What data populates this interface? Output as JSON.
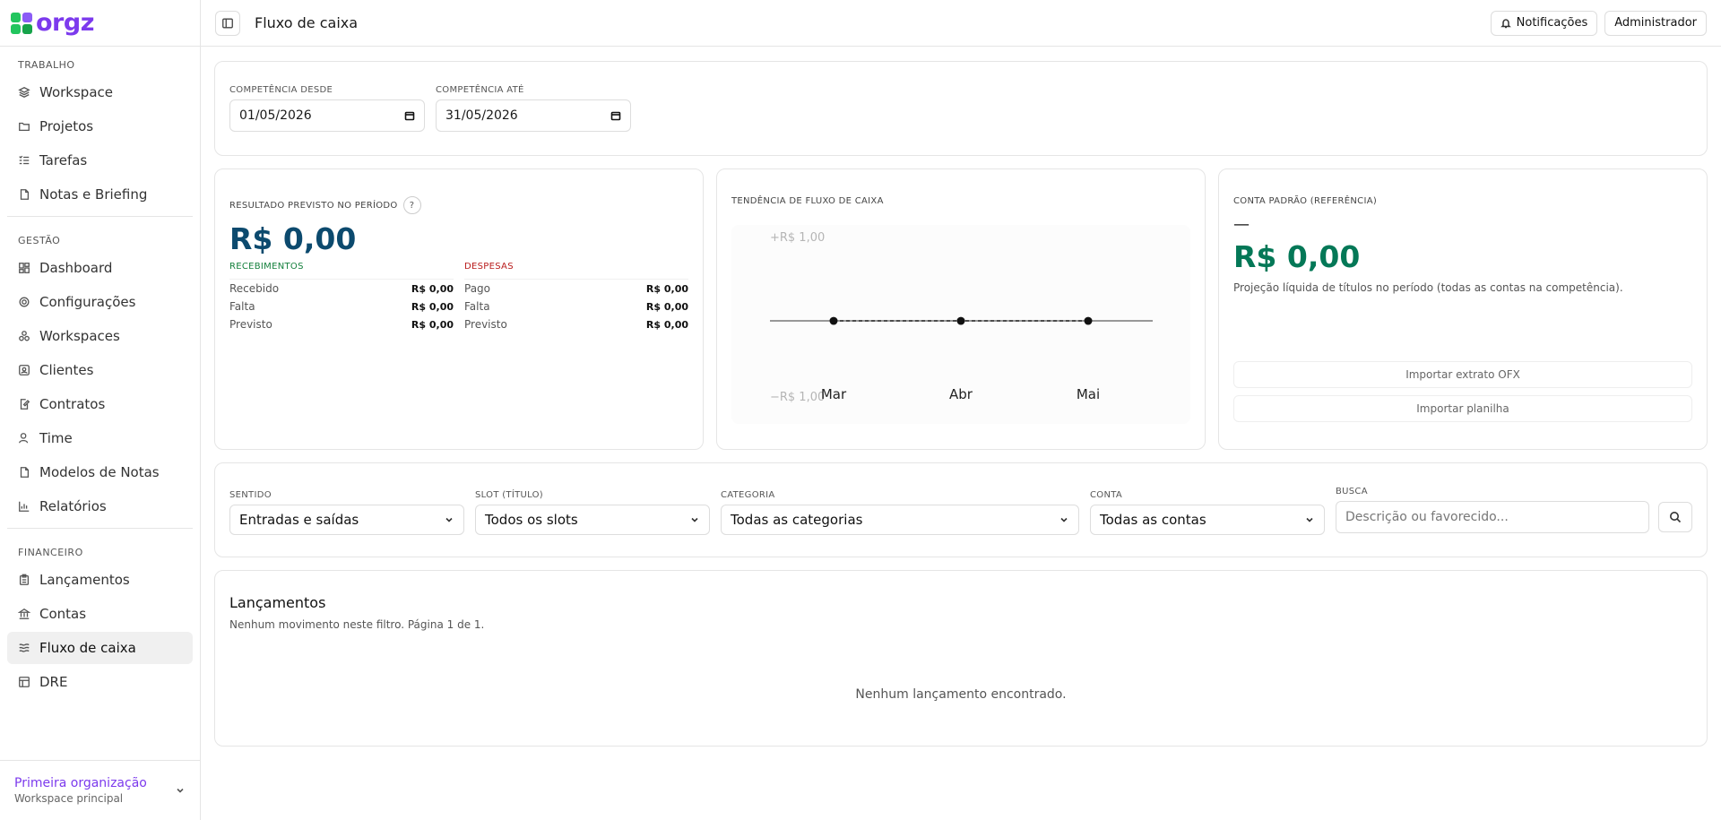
{
  "brand": {
    "name": "orgz"
  },
  "sidebar": {
    "sections": [
      {
        "title": "TRABALHO",
        "items": [
          "Workspace",
          "Projetos",
          "Tarefas",
          "Notas e Briefing"
        ]
      },
      {
        "title": "GESTÃO",
        "items": [
          "Dashboard",
          "Configurações",
          "Workspaces",
          "Clientes",
          "Contratos",
          "Time",
          "Modelos de Notas",
          "Relatórios"
        ]
      },
      {
        "title": "FINANCEIRO",
        "items": [
          "Lançamentos",
          "Contas",
          "Fluxo de caixa",
          "DRE"
        ]
      }
    ],
    "org": {
      "name": "Primeira organização",
      "sub": "Workspace principal"
    }
  },
  "topbar": {
    "title": "Fluxo de caixa",
    "notifications": "Notificações",
    "admin": "Administrador"
  },
  "dates": {
    "from_label": "COMPETÊNCIA DESDE",
    "from_value": "01/05/2026",
    "to_label": "COMPETÊNCIA ATÉ",
    "to_value": "31/05/2026"
  },
  "result": {
    "label": "RESULTADO PREVISTO NO PERÍODO",
    "value": "R$ 0,00",
    "receipts": {
      "title": "RECEBIMENTOS",
      "rows": [
        [
          "Recebido",
          "R$ 0,00"
        ],
        [
          "Falta",
          "R$ 0,00"
        ],
        [
          "Previsto",
          "R$ 0,00"
        ]
      ]
    },
    "expenses": {
      "title": "DESPESAS",
      "rows": [
        [
          "Pago",
          "R$ 0,00"
        ],
        [
          "Falta",
          "R$ 0,00"
        ],
        [
          "Previsto",
          "R$ 0,00"
        ]
      ]
    }
  },
  "trend": {
    "label": "TENDÊNCIA DE FLUXO DE CAIXA"
  },
  "chart_data": {
    "type": "line",
    "categories": [
      "Mar",
      "Abr",
      "Mai"
    ],
    "values": [
      0,
      0,
      0
    ],
    "ylim": [
      -1,
      1
    ],
    "ytick_labels": [
      "+R$ 1,00",
      "−R$ 1,00"
    ]
  },
  "account": {
    "label": "CONTA PADRÃO (REFERÊNCIA)",
    "name": "—",
    "value": "R$ 0,00",
    "desc": "Projeção líquida de títulos no período (todas as contas na competência).",
    "import_ofx": "Importar extrato OFX",
    "import_sheet": "Importar planilha"
  },
  "filters": {
    "sentido_label": "SENTIDO",
    "sentido_value": "Entradas e saídas",
    "slot_label": "SLOT (TÍTULO)",
    "slot_value": "Todos os slots",
    "categoria_label": "CATEGORIA",
    "categoria_value": "Todas as categorias",
    "conta_label": "CONTA",
    "conta_value": "Todas as contas",
    "busca_label": "BUSCA",
    "busca_placeholder": "Descrição ou favorecido..."
  },
  "entries": {
    "title": "Lançamentos",
    "subtitle": "Nenhum movimento neste filtro. Página 1 de 1.",
    "empty": "Nenhum lançamento encontrado."
  }
}
